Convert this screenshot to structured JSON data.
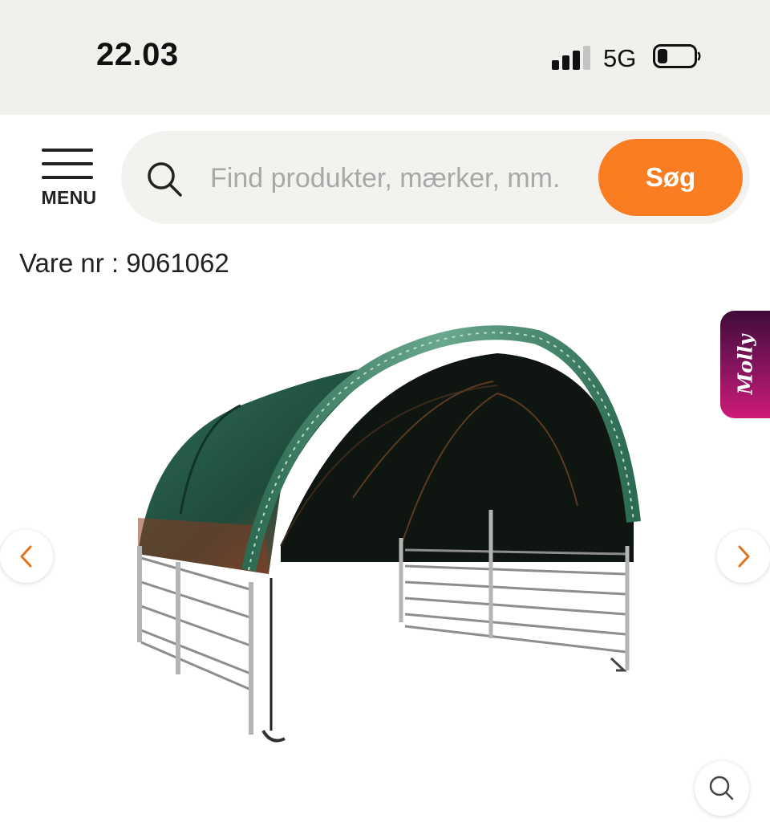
{
  "status_bar": {
    "time": "22.03",
    "network": "5G",
    "icons": [
      "signal-icon",
      "battery-icon"
    ]
  },
  "header": {
    "menu_label": "MENU",
    "search": {
      "placeholder": "Find produkter, mærker, mm.",
      "value": "",
      "button_label": "Søg",
      "button_color": "#fb7d22"
    }
  },
  "product": {
    "item_number_text": "Vare nr : 9061062",
    "image_subject": "green arched shelter tent with steel fence panels",
    "gallery_icons": [
      "chevron-left-icon",
      "chevron-right-icon",
      "zoom-icon"
    ]
  },
  "assistant_tab": {
    "label": "Molly",
    "gradient": [
      "#3f0c38",
      "#cf1a78"
    ]
  }
}
